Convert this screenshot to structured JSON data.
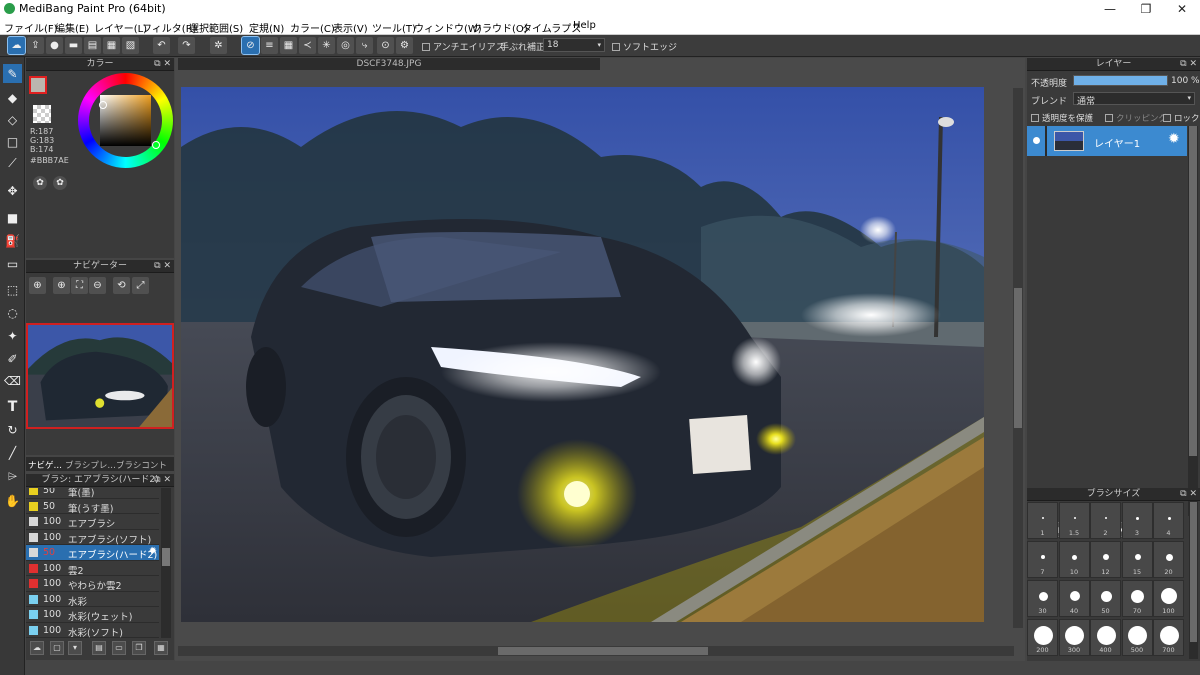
{
  "app": {
    "title": "MediBang Paint Pro (64bit)"
  },
  "window": {
    "minimize": "—",
    "maximize": "❐",
    "close": "✕"
  },
  "menu": [
    "ファイル(F)",
    "編集(E)",
    "レイヤー(L)",
    "フィルタ(R)",
    "選択範囲(S)",
    "定規(N)",
    "カラー(C)",
    "表示(V)",
    "ツール(T)",
    "ウィンドウ(W)",
    "クラウド(O)",
    "タイムラプス",
    "Help"
  ],
  "toolbar": {
    "antialias_label": "アンチエイリアス",
    "stabilizer_label": "手ぶれ補正",
    "stabilizer_value": "18",
    "soft_edge_label": "ソフトエッジ"
  },
  "color_panel": {
    "title": "カラー",
    "r": "R:187",
    "g": "G:183",
    "b": "B:174",
    "hex": "#BBB7AE",
    "main_color": "#BBB7AE"
  },
  "navigator": {
    "title": "ナビゲーター"
  },
  "panel_tabs": [
    "ナビゲ…",
    "ブラシプレ…",
    "ブラシコントロ…"
  ],
  "brush_panel": {
    "title": "ブラシ: エアブラシ(ハード2)",
    "items": [
      {
        "size": "50",
        "name": "筆(墨)",
        "color": "#e8d020"
      },
      {
        "size": "50",
        "name": "筆(うす墨)",
        "color": "#e8d020"
      },
      {
        "size": "100",
        "name": "エアブラシ",
        "color": "#d8d8d8"
      },
      {
        "size": "100",
        "name": "エアブラシ(ソフト)",
        "color": "#d8d8d8"
      },
      {
        "size": "50",
        "name": "エアブラシ(ハード2)",
        "color": "#d8d8d8"
      },
      {
        "size": "100",
        "name": "雲2",
        "color": "#e03030"
      },
      {
        "size": "100",
        "name": "やわらか雲2",
        "color": "#e03030"
      },
      {
        "size": "100",
        "name": "水彩",
        "color": "#7ad0f0"
      },
      {
        "size": "100",
        "name": "水彩(ウェット)",
        "color": "#7ad0f0"
      },
      {
        "size": "100",
        "name": "水彩(ソフト)",
        "color": "#7ad0f0"
      }
    ]
  },
  "document": {
    "tab": "DSCF3748.JPG"
  },
  "layer_panel": {
    "title": "レイヤー",
    "opacity_label": "不透明度",
    "opacity_value": "100 %",
    "opacity_fraction": 1.0,
    "blend_label": "ブレンド",
    "blend_value": "通常",
    "protect_alpha": "透明度を保護",
    "clipping": "クリッピング",
    "lock": "ロック",
    "layer_name": "レイヤー1"
  },
  "brush_size_panel": {
    "title": "ブラシサイズ",
    "sizes": [
      "1",
      "1.5",
      "2",
      "3",
      "4",
      "7",
      "10",
      "12",
      "15",
      "20",
      "30",
      "40",
      "50",
      "70",
      "100",
      "200",
      "300",
      "400",
      "500",
      "700"
    ]
  }
}
